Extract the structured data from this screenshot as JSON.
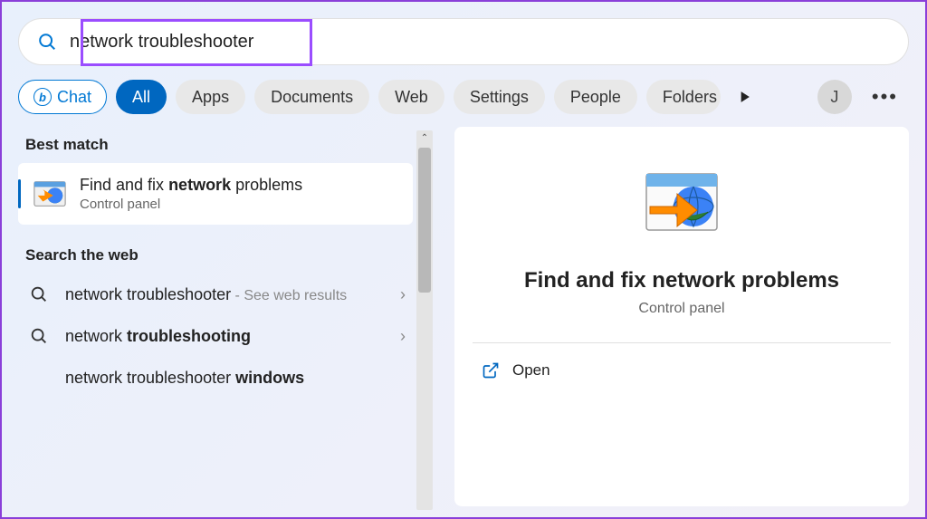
{
  "search": {
    "value": "network troubleshooter"
  },
  "filters": {
    "chat": "Chat",
    "tabs": [
      "All",
      "Apps",
      "Documents",
      "Web",
      "Settings",
      "People",
      "Folders"
    ],
    "activeIndex": 0,
    "userInitial": "J"
  },
  "results": {
    "bestMatchHeader": "Best match",
    "bestMatch": {
      "titlePrefix": "Find and fix ",
      "titleBold": "network",
      "titleSuffix": " problems",
      "subtitle": "Control panel"
    },
    "searchWebHeader": "Search the web",
    "webItems": [
      {
        "prefix": "network troubleshooter",
        "bold": "",
        "suffix": " - See web results"
      },
      {
        "prefix": "network ",
        "bold": "troubleshooting",
        "suffix": ""
      },
      {
        "prefix": "network troubleshooter ",
        "bold": "windows",
        "suffix": ""
      }
    ]
  },
  "detail": {
    "title": "Find and fix network problems",
    "subtitle": "Control panel",
    "actions": {
      "open": "Open"
    }
  }
}
